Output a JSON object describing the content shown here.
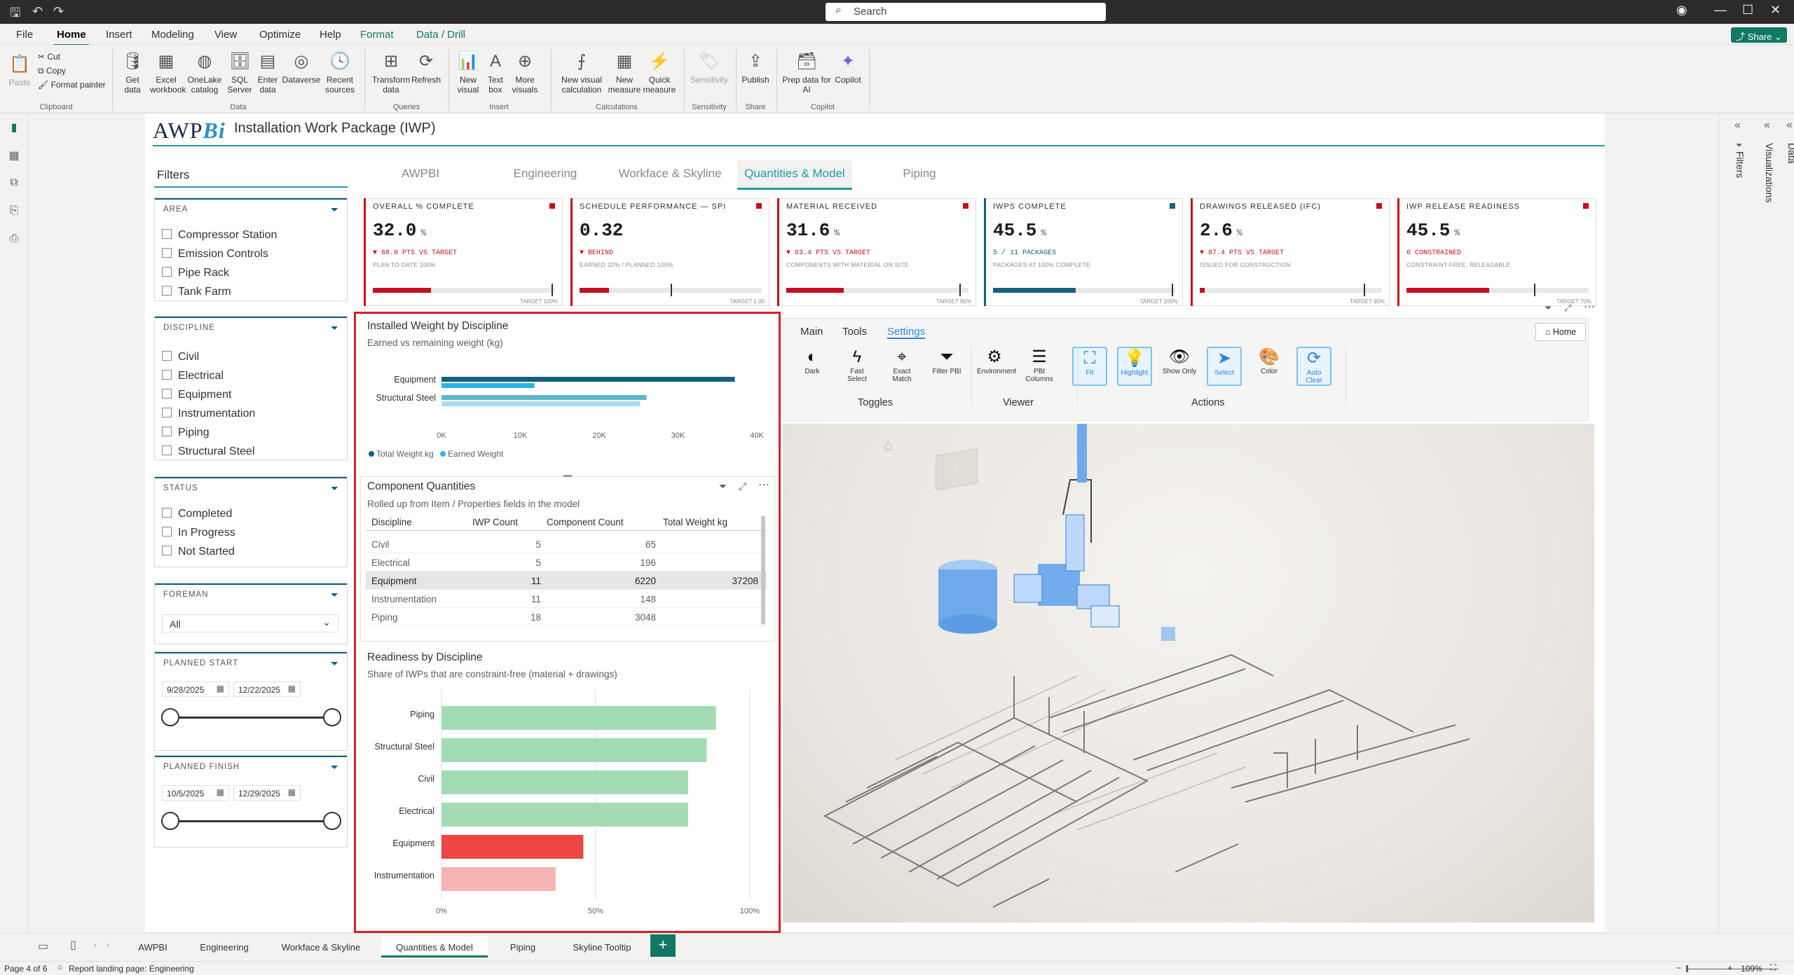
{
  "window": {
    "search_placeholder": "Search"
  },
  "menu": {
    "items": [
      "File",
      "Home",
      "Insert",
      "Modeling",
      "View",
      "Optimize",
      "Help",
      "Format",
      "Data / Drill"
    ],
    "share": "Share"
  },
  "ribbon": {
    "clipboard": {
      "paste": "Paste",
      "cut": "Cut",
      "copy": "Copy",
      "format_painter": "Format painter",
      "group": "Clipboard"
    },
    "data": {
      "get_data": "Get data",
      "excel": "Excel workbook",
      "onelake": "OneLake catalog",
      "sql": "SQL Server",
      "enter": "Enter data",
      "dataverse": "Dataverse",
      "recent": "Recent sources",
      "group": "Data"
    },
    "queries": {
      "transform": "Transform data",
      "refresh": "Refresh",
      "group": "Queries"
    },
    "insert": {
      "new_visual": "New visual",
      "text_box": "Text box",
      "more_visuals": "More visuals",
      "group": "Insert"
    },
    "calculations": {
      "new_visual_calc": "New visual calculation",
      "new_measure": "New measure",
      "quick_measure": "Quick measure",
      "group": "Calculations"
    },
    "sensitivity": {
      "label": "Sensitivity",
      "group": "Sensitivity"
    },
    "share": {
      "publish": "Publish",
      "group": "Share"
    },
    "copilot": {
      "prep": "Prep data for AI",
      "copilot": "Copilot",
      "group": "Copilot"
    }
  },
  "report": {
    "logo_a": "AWP",
    "logo_b": "Bi",
    "title": "Installation Work Package (IWP)"
  },
  "filters": {
    "title": "Filters",
    "area": {
      "header": "AREA",
      "items": [
        "Compressor Station",
        "Emission Controls",
        "Pipe Rack",
        "Tank Farm"
      ]
    },
    "discipline": {
      "header": "DISCIPLINE",
      "items": [
        "Civil",
        "Electrical",
        "Equipment",
        "Instrumentation",
        "Piping",
        "Structural Steel"
      ]
    },
    "status": {
      "header": "STATUS",
      "items": [
        "Completed",
        "In Progress",
        "Not Started"
      ]
    },
    "foreman": {
      "header": "FOREMAN",
      "value": "All"
    },
    "planned_start": {
      "header": "PLANNED START",
      "from": "9/28/2025",
      "to": "12/22/2025"
    },
    "planned_finish": {
      "header": "PLANNED FINISH",
      "from": "10/5/2025",
      "to": "12/29/2025"
    }
  },
  "tabs": [
    "AWPBI",
    "Engineering",
    "Workface & Skyline",
    "Quantities & Model",
    "Piping"
  ],
  "kpis": [
    {
      "label": "OVERALL % COMPLETE",
      "value": "32.0",
      "unit": "%",
      "delta": "▼ 68.0 PTS VS TARGET",
      "note": "PLAN TO DATE 100%",
      "target": "TARGET 100%",
      "progress": 0.32,
      "target_pos": 0.98,
      "color": "#c50f1f"
    },
    {
      "label": "SCHEDULE PERFORMANCE — SPI",
      "value": "0.32",
      "unit": "",
      "delta": "▼ BEHIND",
      "note": "EARNED 32% / PLANNED 100%",
      "target": "TARGET 1.00",
      "progress": 0.16,
      "target_pos": 0.5,
      "color": "#c50f1f"
    },
    {
      "label": "MATERIAL RECEIVED",
      "value": "31.6",
      "unit": "%",
      "delta": "▼ 63.4 PTS VS TARGET",
      "note": "COMPONENTS WITH MATERIAL ON SITE",
      "target": "TARGET 95%",
      "progress": 0.316,
      "target_pos": 0.95,
      "color": "#c50f1f"
    },
    {
      "label": "IWPS COMPLETE",
      "value": "45.5",
      "unit": "%",
      "delta": "5 / 11 PACKAGES",
      "note": "PACKAGES AT 100% COMPLETE",
      "target": "TARGET 100%",
      "progress": 0.455,
      "target_pos": 0.98,
      "color": "#13607c",
      "deltaColor": "#13607c"
    },
    {
      "label": "DRAWINGS RELEASED (IFC)",
      "value": "2.6",
      "unit": "%",
      "delta": "▼ 87.4 PTS VS TARGET",
      "note": "ISSUED FOR CONSTRUCTION",
      "target": "TARGET 90%",
      "progress": 0.026,
      "target_pos": 0.9,
      "color": "#c50f1f"
    },
    {
      "label": "IWP RELEASE READINESS",
      "value": "45.5",
      "unit": "%",
      "delta": "6 CONSTRAINED",
      "note": "CONSTRAINT-FREE, RELEASABLE",
      "target": "TARGET 70%",
      "progress": 0.455,
      "target_pos": 0.7,
      "color": "#c50f1f"
    }
  ],
  "installed_weight": {
    "title": "Installed Weight by Discipline",
    "subtitle": "Earned vs remaining weight (kg)",
    "legend": [
      "Total Weight kg",
      "Earned Weight"
    ],
    "colors": {
      "total": "#13607c",
      "earned": "#2bb5e8",
      "total_light": "#5fb6c8",
      "earned_light": "#a6dcf2"
    }
  },
  "component_quantities": {
    "title": "Component Quantities",
    "subtitle": "Rolled up from Item / Properties fields in the model",
    "columns": [
      "Discipline",
      "IWP Count",
      "Component Count",
      "Total Weight kg"
    ],
    "rows": [
      [
        "Civil",
        "5",
        "65",
        ""
      ],
      [
        "Electrical",
        "5",
        "196",
        ""
      ],
      [
        "Equipment",
        "11",
        "6220",
        "37208"
      ],
      [
        "Instrumentation",
        "11",
        "148",
        ""
      ],
      [
        "Piping",
        "18",
        "3048",
        ""
      ]
    ]
  },
  "readiness": {
    "title": "Readiness by Discipline",
    "subtitle": "Share of IWPs that are constraint-free (material + drawings)"
  },
  "chart_data": [
    {
      "type": "bar",
      "title": "Installed Weight by Discipline",
      "categories": [
        "Equipment",
        "Structural Steel"
      ],
      "series": [
        {
          "name": "Total Weight kg",
          "values": [
            37208,
            26000
          ]
        },
        {
          "name": "Earned Weight",
          "values": [
            11800,
            25200
          ]
        }
      ],
      "xlim": [
        0,
        40000
      ],
      "xticks": [
        "0K",
        "10K",
        "20K",
        "30K",
        "40K"
      ],
      "legend": "bottom-left"
    },
    {
      "type": "bar",
      "title": "Readiness by Discipline",
      "categories": [
        "Piping",
        "Structural Steel",
        "Civil",
        "Electrical",
        "Equipment",
        "Instrumentation"
      ],
      "values": [
        89,
        86,
        80,
        80,
        46,
        37
      ],
      "colors": [
        "#a3dcb3",
        "#a3dcb3",
        "#a3dcb3",
        "#a3dcb3",
        "#ee4545",
        "#f6b4b4"
      ],
      "xlim": [
        0,
        100
      ],
      "xticks": [
        "0%",
        "50%",
        "100%"
      ]
    }
  ],
  "viewer_toolbar": {
    "tabs": [
      "Main",
      "Tools",
      "Settings"
    ],
    "home": "Home",
    "tools": [
      {
        "icon": "◐",
        "label": "Dark"
      },
      {
        "icon": "ϟ",
        "label": "Fast Select"
      },
      {
        "icon": "⌖",
        "label": "Exact Match"
      },
      {
        "icon": "⏷",
        "label": "Filter PBI"
      },
      {
        "icon": "⚙",
        "label": "Environment"
      },
      {
        "icon": "☰",
        "label": "PBI Columns"
      },
      {
        "icon": "⛶",
        "label": "Fit"
      },
      {
        "icon": "💡",
        "label": "Highlight"
      },
      {
        "icon": "👁",
        "label": "Show Only"
      },
      {
        "icon": "➤",
        "label": "Select"
      },
      {
        "icon": "🎨",
        "label": "Color"
      },
      {
        "icon": "⟳",
        "label": "Auto Clear"
      }
    ],
    "groups": [
      "Toggles",
      "Viewer",
      "Actions"
    ]
  },
  "side_panes": {
    "filters": "Filters",
    "visualizations": "Visualizations",
    "data": "Data"
  },
  "pages": [
    "AWPBI",
    "Engineering",
    "Workface & Skyline",
    "Quantities & Model",
    "Piping",
    "Skyline Tooltip"
  ],
  "status": {
    "page": "Page 4 of 6",
    "landing": "Report landing page: Engineering",
    "zoom": "109%"
  }
}
